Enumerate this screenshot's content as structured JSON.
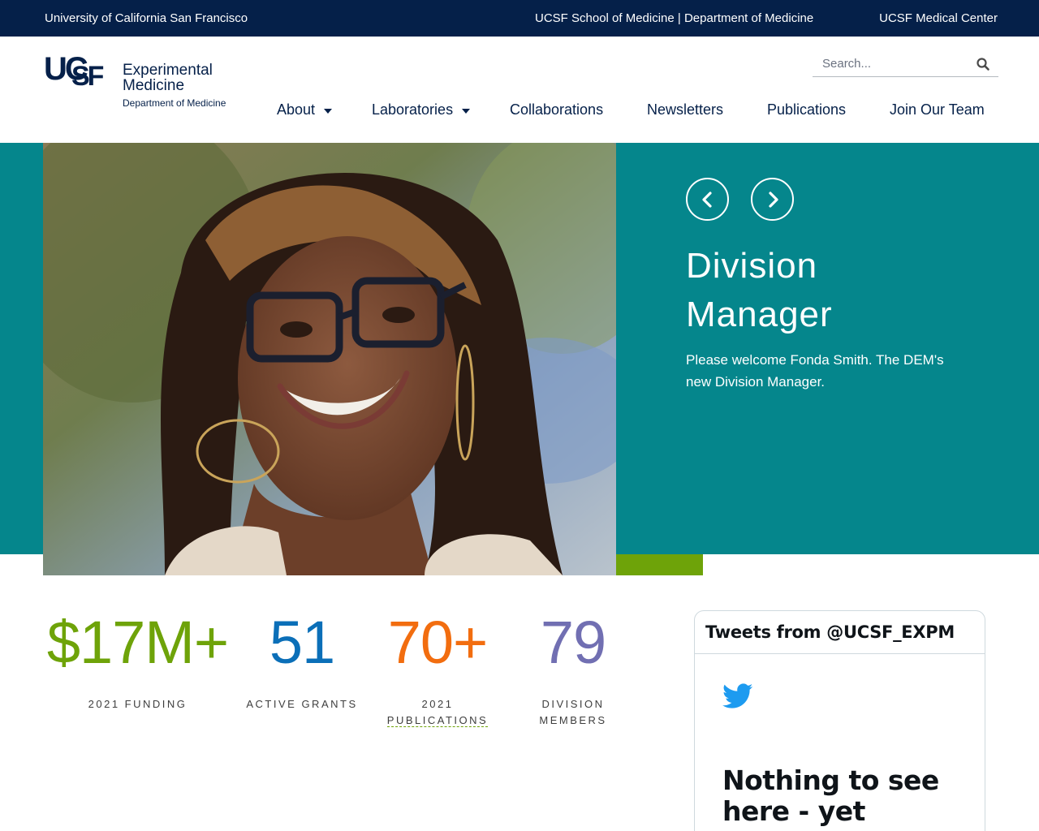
{
  "utility_bar": {
    "university": "University of California San Francisco",
    "school_dept": "UCSF School of Medicine | Department of Medicine",
    "medical_center": "UCSF Medical Center"
  },
  "logo": {
    "mark_uc": "UC",
    "mark_sf": "SF",
    "title_line1": "Experimental",
    "title_line2": "Medicine",
    "subtitle": "Department of Medicine"
  },
  "search": {
    "placeholder": "Search...",
    "value": ""
  },
  "nav": {
    "items": [
      {
        "label": "About",
        "has_dropdown": true
      },
      {
        "label": "Laboratories",
        "has_dropdown": true
      },
      {
        "label": "Collaborations",
        "has_dropdown": false
      },
      {
        "label": "Newsletters",
        "has_dropdown": false
      },
      {
        "label": "Publications",
        "has_dropdown": false
      },
      {
        "label": "Join Our Team",
        "has_dropdown": false
      }
    ]
  },
  "hero": {
    "title_line1": "Division",
    "title_line2": "Manager",
    "description": "Please welcome Fonda Smith. The DEM's new Division Manager.",
    "prev_icon": "chevron-left-icon",
    "next_icon": "chevron-right-icon"
  },
  "stats": [
    {
      "value": "$17M+",
      "label_line1": "2021 FUNDING",
      "label_line2": "",
      "color": "#6ea309"
    },
    {
      "value": "51",
      "label_line1": "ACTIVE GRANTS",
      "label_line2": "",
      "color": "#0b6fb8"
    },
    {
      "value": "70+",
      "label_prefix": "2021 ",
      "label_link": "PUBLICATIONS",
      "color": "#f26d0f"
    },
    {
      "value": "79",
      "label_line1": "DIVISION",
      "label_line2": "MEMBERS",
      "color": "#716fb2"
    }
  ],
  "tweets": {
    "header": "Tweets from @UCSF_EXPM",
    "empty_line1": "Nothing to see",
    "empty_line2": "here - yet"
  },
  "colors": {
    "navy": "#052049",
    "teal": "#05868c",
    "green": "#6ea309",
    "blue": "#0b6fb8",
    "orange": "#f26d0f",
    "purple": "#716fb2",
    "twitter_blue": "#1d9bf0"
  }
}
